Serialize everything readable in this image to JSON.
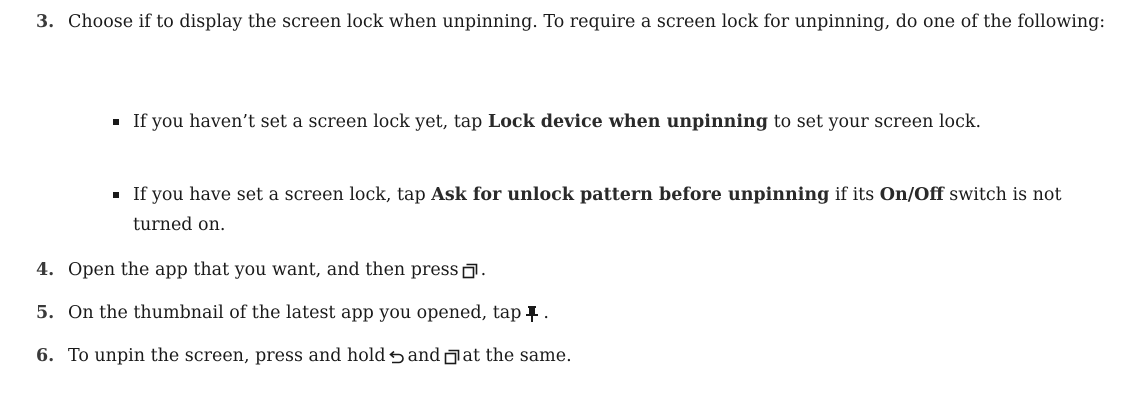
{
  "steps": {
    "s3": {
      "number": "3.",
      "text": "Choose if to display the screen lock when unpinning. To require a screen lock for unpinning, do one of the following:"
    },
    "b1": {
      "pre": "If you haven’t set a screen lock yet, tap ",
      "bold": "Lock device when unpinning",
      "post": " to set your screen lock."
    },
    "b2": {
      "pre": "If you have set a screen lock, tap ",
      "bold": "Ask for unlock pattern before unpinning",
      "mid": " if its ",
      "bold2": "On/Off",
      "post": " switch is not turned on."
    },
    "s4": {
      "number": "4.",
      "pre": "Open the app that you want, and then press",
      "icon": "recent-apps-icon",
      "post": "."
    },
    "s5": {
      "number": "5.",
      "pre": "On the thumbnail of the latest app you opened, tap",
      "icon": "pin-icon",
      "post": "."
    },
    "s6": {
      "number": "6.",
      "pre": "To unpin the screen, press and hold",
      "icon1": "back-icon",
      "mid": "and",
      "icon2": "recent-apps-icon",
      "post": "at the same."
    }
  }
}
